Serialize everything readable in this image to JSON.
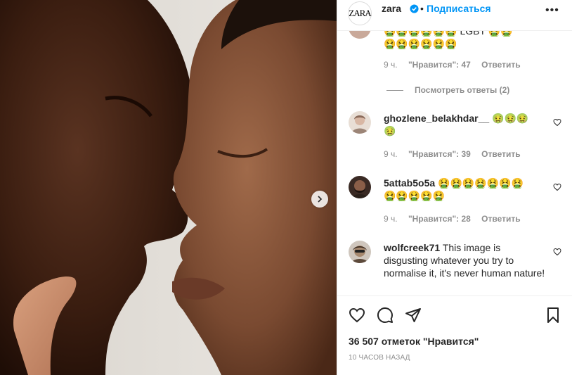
{
  "post": {
    "brand_logo_text": "ZARA",
    "username": "zara",
    "separator": "•",
    "follow_label": "Подписаться",
    "more_label": "•••"
  },
  "comments": [
    {
      "text_partial": "🤮🤮🤮🤮🤮🤮 LGBT 🤮🤮",
      "text_line2": "🤮🤮🤮🤮🤮🤮",
      "time": "9 ч.",
      "likes": "\"Нравится\": 47",
      "reply_label": "Ответить",
      "view_replies": "Посмотреть ответы (2)"
    },
    {
      "username": "ghozlene_belakhdar__",
      "text": "🤢🤢🤢",
      "text_line2": "🤢",
      "time": "9 ч.",
      "likes": "\"Нравится\": 39",
      "reply_label": "Ответить"
    },
    {
      "username": "5attab5o5a",
      "text": "🤮🤮🤮🤮🤮🤮🤮",
      "text_line2": "🤮🤮🤮🤮🤮",
      "time": "9 ч.",
      "likes": "\"Нравится\": 28",
      "reply_label": "Ответить"
    },
    {
      "username": "wolfcreek71",
      "text": "This image is disgusting whatever you try to normalise it, it's never human nature!"
    }
  ],
  "footer": {
    "likes_count": "36 507 отметок \"Нравится\"",
    "posted_time": "10 ЧАСОВ НАЗАД"
  },
  "colors": {
    "accent": "#0095f6",
    "text": "#262626",
    "muted": "#8e8e8e",
    "border": "#efefef"
  }
}
